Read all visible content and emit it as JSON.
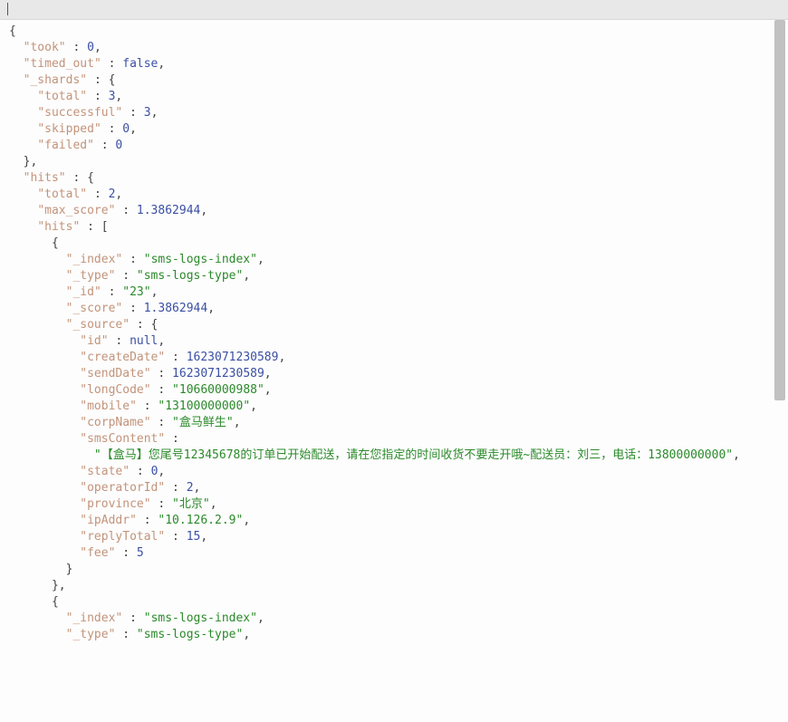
{
  "chart_data": {
    "type": "table",
    "title": "Elasticsearch search response (sms-logs-index)",
    "json": {
      "took": 0,
      "timed_out": false,
      "_shards": {
        "total": 3,
        "successful": 3,
        "skipped": 0,
        "failed": 0
      },
      "hits": {
        "total": 2,
        "max_score": 1.3862944,
        "hits": [
          {
            "_index": "sms-logs-index",
            "_type": "sms-logs-type",
            "_id": "23",
            "_score": 1.3862944,
            "_source": {
              "id": null,
              "createDate": 1623071230589,
              "sendDate": 1623071230589,
              "longCode": "10660000988",
              "mobile": "13100000000",
              "corpName": "盒马鲜生",
              "smsContent": "【盒马】您尾号12345678的订单已开始配送，请在您指定的时间收货不要走开哦~配送员：刘三，电话：13800000000",
              "state": 0,
              "operatorId": 2,
              "province": "北京",
              "ipAddr": "10.126.2.9",
              "replyTotal": 15,
              "fee": 5
            }
          },
          {
            "_index": "sms-logs-index",
            "_type": "sms-logs-type"
          }
        ]
      }
    }
  },
  "labels": {
    "took": "took",
    "timed_out": "timed_out",
    "_shards": "_shards",
    "total": "total",
    "successful": "successful",
    "skipped": "skipped",
    "failed": "failed",
    "hits": "hits",
    "max_score": "max_score",
    "_index": "_index",
    "_type": "_type",
    "_id": "_id",
    "_score": "_score",
    "_source": "_source",
    "id": "id",
    "createDate": "createDate",
    "sendDate": "sendDate",
    "longCode": "longCode",
    "mobile": "mobile",
    "corpName": "corpName",
    "smsContent": "smsContent",
    "state": "state",
    "operatorId": "operatorId",
    "province": "province",
    "ipAddr": "ipAddr",
    "replyTotal": "replyTotal",
    "fee": "fee"
  },
  "values": {
    "took": "0",
    "timed_out": "false",
    "shards_total": "3",
    "shards_successful": "3",
    "shards_skipped": "0",
    "shards_failed": "0",
    "hits_total": "2",
    "max_score": "1.3862944",
    "h0_index": "sms-logs-index",
    "h0_type": "sms-logs-type",
    "h0_id": "23",
    "h0_score": "1.3862944",
    "src_id": "null",
    "createDate": "1623071230589",
    "sendDate": "1623071230589",
    "longCode": "10660000988",
    "mobile": "13100000000",
    "corpName": "盒马鲜生",
    "smsContent": "【盒马】您尾号12345678的订单已开始配送，请在您指定的时间收货不要走开哦~配送员：刘三，电话：13800000000",
    "state": "0",
    "operatorId": "2",
    "province": "北京",
    "ipAddr": "10.126.2.9",
    "replyTotal": "15",
    "fee": "5",
    "h1_index": "sms-logs-index",
    "h1_type": "sms-logs-type"
  }
}
